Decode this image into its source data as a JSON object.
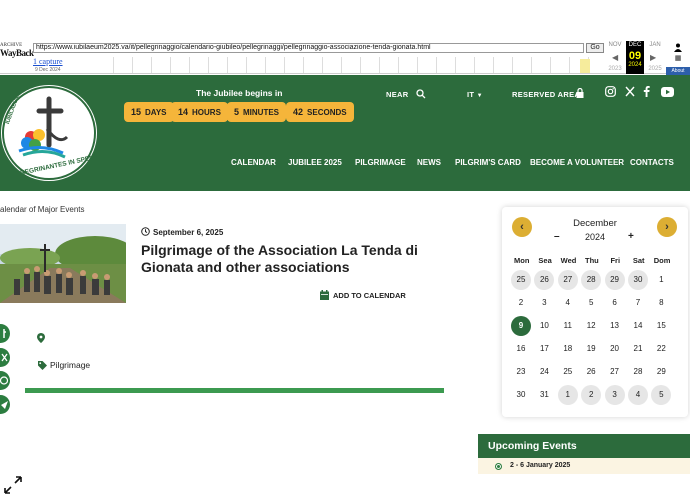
{
  "wayback": {
    "logo_top": "ARCHIVE",
    "logo_main": "WayBack",
    "url": "https://www.iubilaeum2025.va/it/pellegrinaggio/calendario-giubileo/pellegrinaggi/pellegrinaggio-associazione-tenda-gionata.html",
    "go_label": "Go",
    "captures": "1 capture",
    "capture_date": "9 Dec 2024",
    "month_prev": "NOV",
    "month_cur": "DEC",
    "month_next": "JAN",
    "day_cur": "09",
    "year_prev": "2023",
    "year_cur": "2024",
    "year_next": "2025",
    "about_label": "About"
  },
  "header": {
    "countdown_title": "The Jubilee begins in",
    "countdown": [
      {
        "value": "15",
        "unit": "DAYS"
      },
      {
        "value": "14",
        "unit": "HOURS"
      },
      {
        "value": "5",
        "unit": "MINUTES"
      },
      {
        "value": "42",
        "unit": "SECONDS"
      }
    ],
    "near_label": "NEAR",
    "lang_label": "IT",
    "reserved_label": "RESERVED AREA",
    "menu": [
      "CALENDAR",
      "JUBILEE 2025",
      "PILGRIMAGE",
      "NEWS",
      "PILGRIM'S CARD",
      "BECOME A VOLUNTEER",
      "CONTACTS"
    ]
  },
  "logo": {
    "top_text": "IUBILAEUM A. D. MMXXV",
    "bottom_text": "PEREGRINANTES IN SPEM"
  },
  "breadcrumb": "alendar of Major Events",
  "event": {
    "date": "September 6, 2025",
    "title": "Pilgrimage of the Association La Tenda di Gionata and other associations",
    "add_calendar": "ADD TO CALENDAR",
    "tag": "Pilgrimage"
  },
  "calendar": {
    "month": "December",
    "year": "2024",
    "minus": "–",
    "plus": "+",
    "days": [
      "Mon",
      "Sea",
      "Wed",
      "Thu",
      "Fri",
      "Sat",
      "Dom"
    ],
    "cells": [
      {
        "d": "25",
        "k": "o"
      },
      {
        "d": "26",
        "k": "o"
      },
      {
        "d": "27",
        "k": "o"
      },
      {
        "d": "28",
        "k": "o"
      },
      {
        "d": "29",
        "k": "o"
      },
      {
        "d": "30",
        "k": "o"
      },
      {
        "d": "1",
        "k": ""
      },
      {
        "d": "2",
        "k": ""
      },
      {
        "d": "3",
        "k": ""
      },
      {
        "d": "4",
        "k": ""
      },
      {
        "d": "5",
        "k": ""
      },
      {
        "d": "6",
        "k": ""
      },
      {
        "d": "7",
        "k": ""
      },
      {
        "d": "8",
        "k": ""
      },
      {
        "d": "9",
        "k": "t"
      },
      {
        "d": "10",
        "k": ""
      },
      {
        "d": "11",
        "k": ""
      },
      {
        "d": "12",
        "k": ""
      },
      {
        "d": "13",
        "k": ""
      },
      {
        "d": "14",
        "k": ""
      },
      {
        "d": "15",
        "k": ""
      },
      {
        "d": "16",
        "k": ""
      },
      {
        "d": "17",
        "k": ""
      },
      {
        "d": "18",
        "k": ""
      },
      {
        "d": "19",
        "k": ""
      },
      {
        "d": "20",
        "k": ""
      },
      {
        "d": "21",
        "k": ""
      },
      {
        "d": "22",
        "k": ""
      },
      {
        "d": "23",
        "k": ""
      },
      {
        "d": "24",
        "k": ""
      },
      {
        "d": "25",
        "k": ""
      },
      {
        "d": "26",
        "k": ""
      },
      {
        "d": "27",
        "k": ""
      },
      {
        "d": "28",
        "k": ""
      },
      {
        "d": "29",
        "k": ""
      },
      {
        "d": "30",
        "k": ""
      },
      {
        "d": "31",
        "k": ""
      },
      {
        "d": "1",
        "k": "o"
      },
      {
        "d": "2",
        "k": "o"
      },
      {
        "d": "3",
        "k": "o"
      },
      {
        "d": "4",
        "k": "o"
      },
      {
        "d": "5",
        "k": "o"
      }
    ]
  },
  "upcoming": {
    "title": "Upcoming Events",
    "first": "2 - 6 January 2025"
  },
  "colors": {
    "brand_green": "#2c6b3c",
    "accent_gold": "#f5b53a"
  }
}
